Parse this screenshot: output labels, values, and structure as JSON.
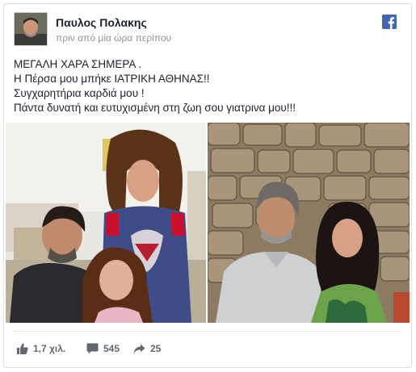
{
  "post": {
    "author": "Παυλος Πολακης",
    "time": "πριν από μία ώρα περίπου",
    "lines": [
      "ΜΕΓΑΛΗ ΧΑΡΑ ΣΗΜΕΡΑ .",
      "Η Πέρσα μου μπήκε ΙΑΤΡΙΚΗ ΑΘΗΝΑΣ!!",
      "Συγχαρητήρια καρδιά μου !",
      "Πάντα δυνατή και ευτυχισμένη στη ζωη σου γιατρινα μου!!!"
    ]
  },
  "stats": {
    "likes": "1,7 χιλ.",
    "comments": "545",
    "shares": "25"
  },
  "icons": {
    "brand": "facebook-icon",
    "likes": "thumbs-up-icon",
    "comments": "comment-icon",
    "shares": "share-arrow-icon"
  },
  "colors": {
    "facebook_blue": "#4267b2",
    "stat_gray": "#606770",
    "time_gray": "#90949c"
  }
}
